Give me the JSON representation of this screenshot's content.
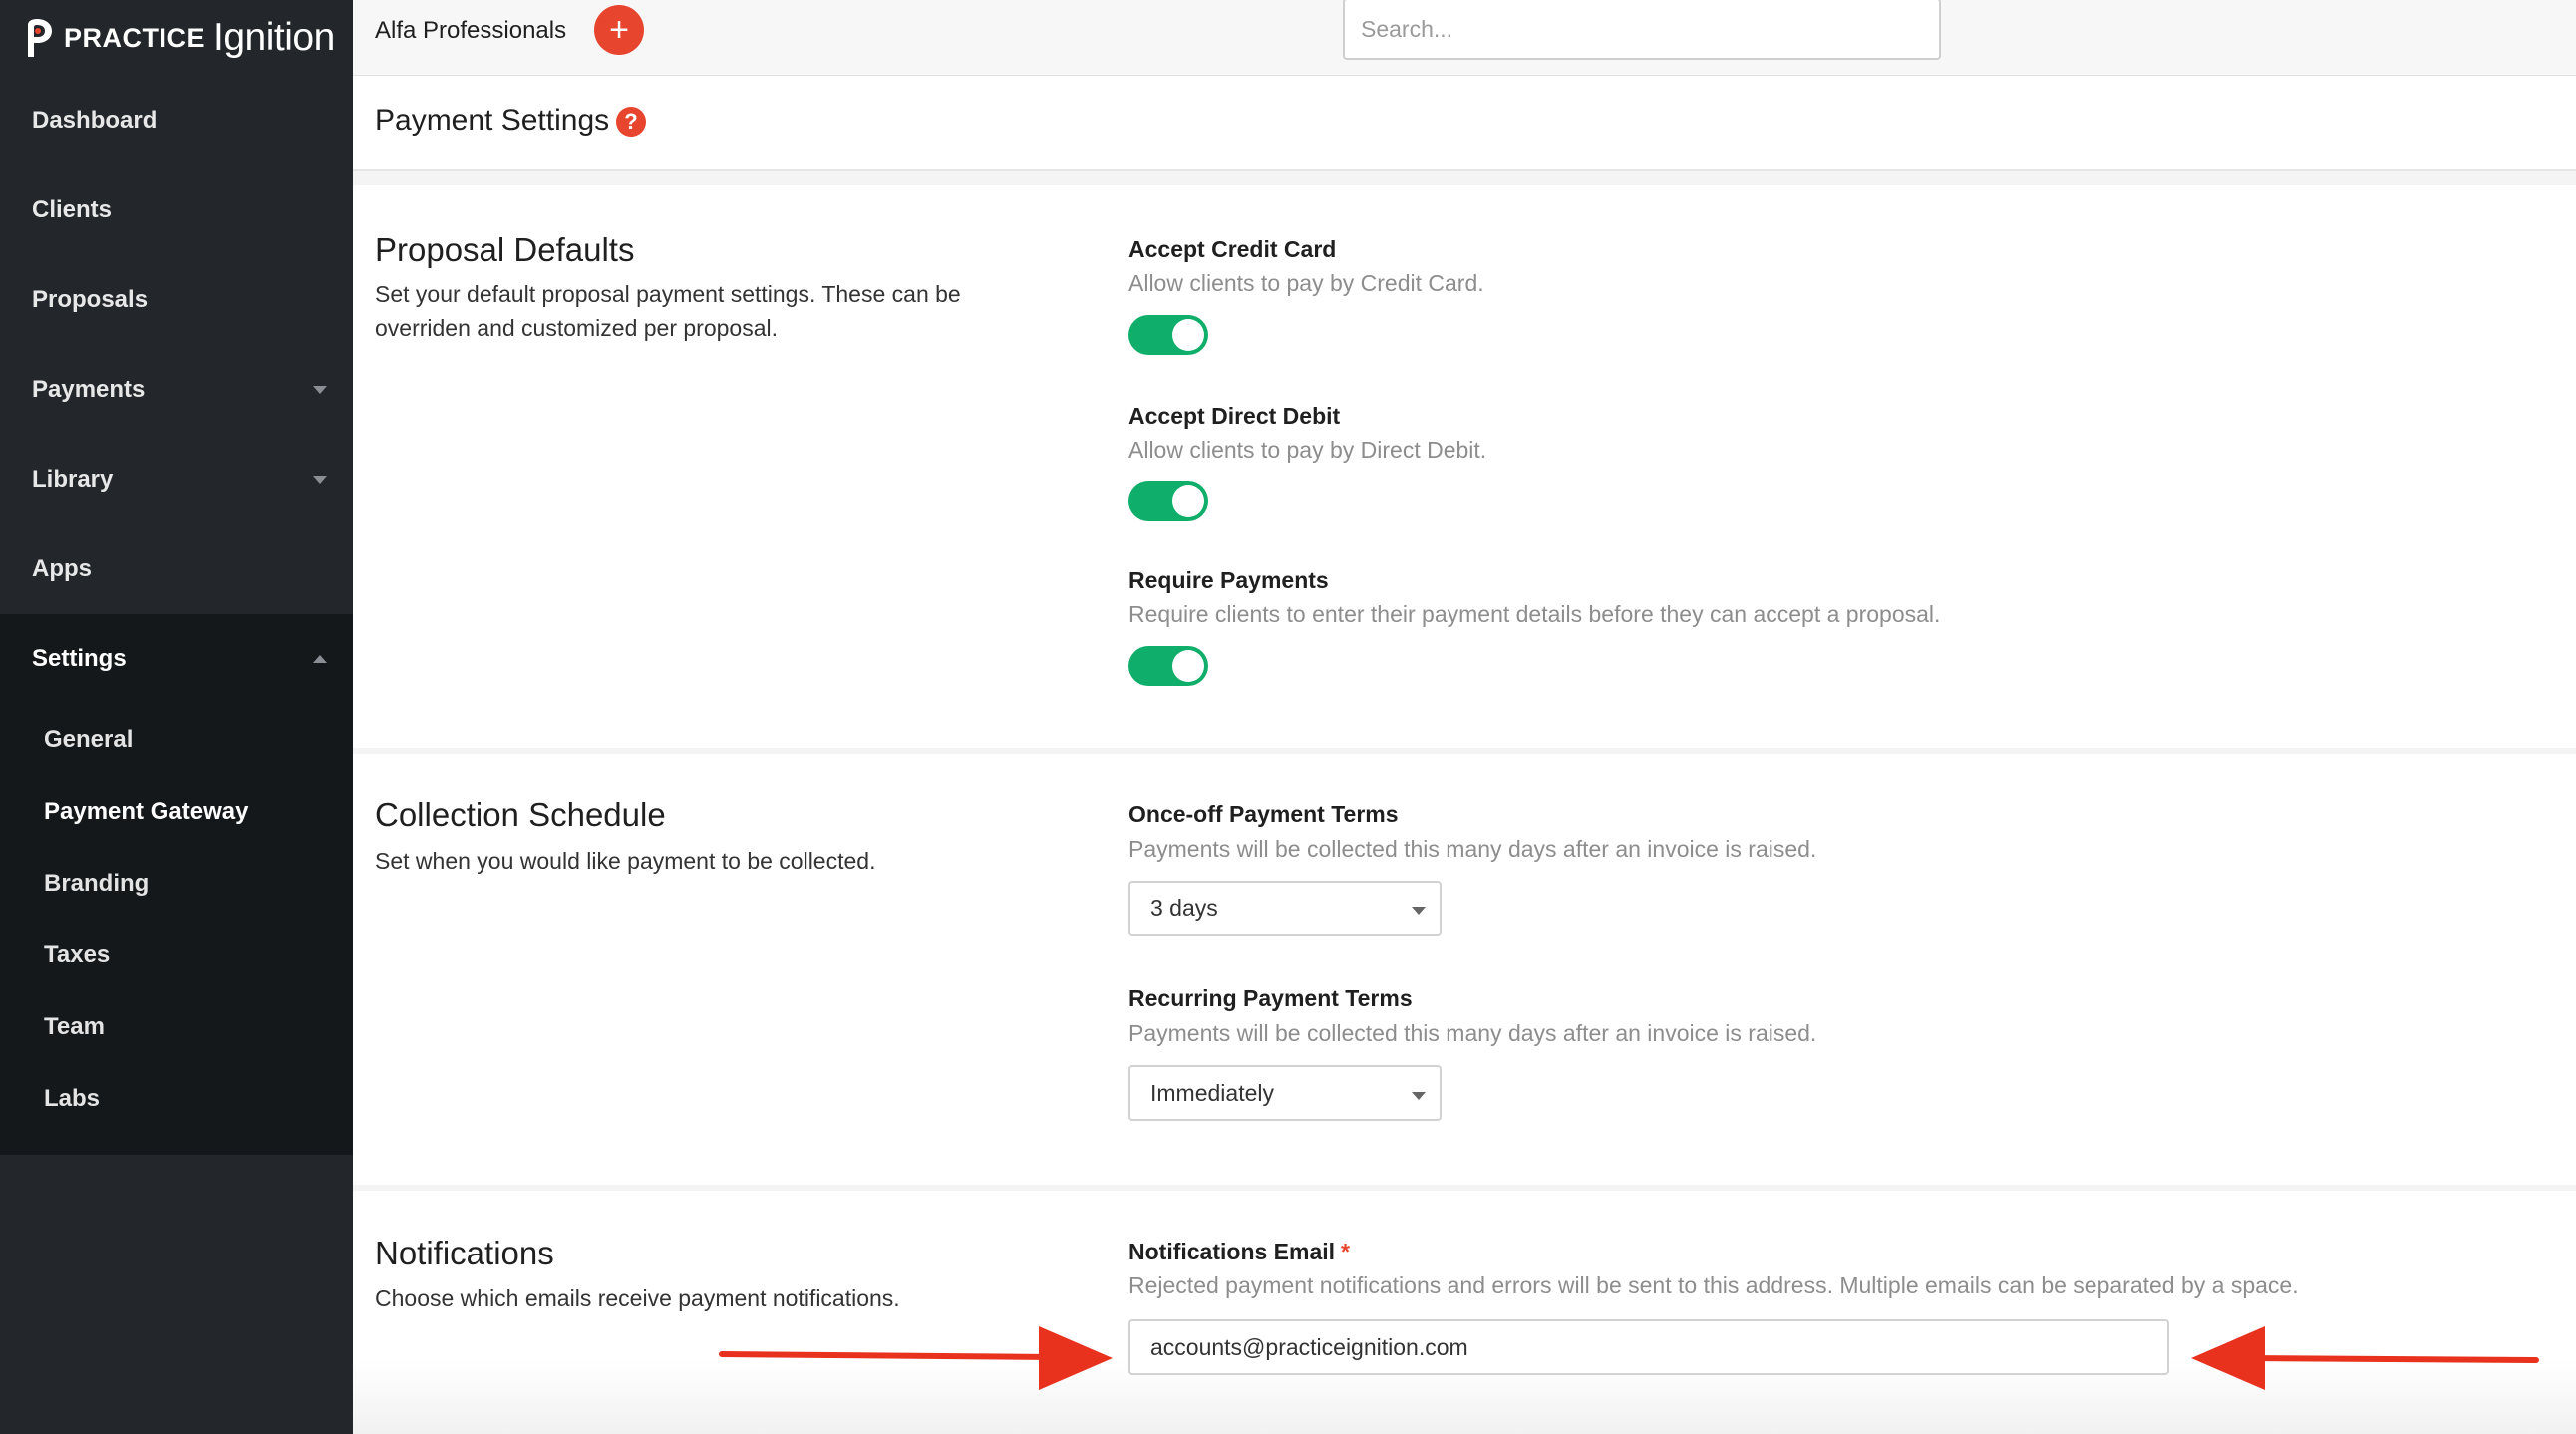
{
  "brand": {
    "practice": "PRACTICE",
    "ignition": "Ignition",
    "accent": "#e8452e",
    "toggle_on": "#0fae6a"
  },
  "sidebar": {
    "items": [
      {
        "label": "Dashboard"
      },
      {
        "label": "Clients"
      },
      {
        "label": "Proposals"
      },
      {
        "label": "Payments",
        "icon": "chevron-down-icon"
      },
      {
        "label": "Library",
        "icon": "chevron-down-icon"
      },
      {
        "label": "Apps"
      }
    ],
    "settings": {
      "label": "Settings",
      "icon": "chevron-up-icon",
      "children": [
        {
          "label": "General"
        },
        {
          "label": "Payment Gateway",
          "active": true
        },
        {
          "label": "Branding"
        },
        {
          "label": "Taxes"
        },
        {
          "label": "Team"
        },
        {
          "label": "Labs"
        }
      ]
    }
  },
  "topbar": {
    "org_name": "Alfa Professionals",
    "add_label": "+",
    "search_placeholder": "Search..."
  },
  "page": {
    "title": "Payment Settings",
    "help_label": "?"
  },
  "sections": {
    "proposal_defaults": {
      "heading": "Proposal Defaults",
      "description": "Set your default proposal payment settings. These can be overriden and customized per proposal.",
      "fields": [
        {
          "label": "Accept Credit Card",
          "help": "Allow clients to pay by Credit Card.",
          "enabled": true
        },
        {
          "label": "Accept Direct Debit",
          "help": "Allow clients to pay by Direct Debit.",
          "enabled": true
        },
        {
          "label": "Require Payments",
          "help": "Require clients to enter their payment details before they can accept a proposal.",
          "enabled": true
        }
      ]
    },
    "collection_schedule": {
      "heading": "Collection Schedule",
      "description": "Set when you would like payment to be collected.",
      "fields": [
        {
          "label": "Once-off Payment Terms",
          "help": "Payments will be collected this many days after an invoice is raised.",
          "value": "3 days"
        },
        {
          "label": "Recurring Payment Terms",
          "help": "Payments will be collected this many days after an invoice is raised.",
          "value": "Immediately"
        }
      ]
    },
    "notifications": {
      "heading": "Notifications",
      "description": "Choose which emails receive payment notifications.",
      "email_label": "Notifications Email",
      "required_mark": "*",
      "email_help": "Rejected payment notifications and errors will be sent to this address. Multiple emails can be separated by a space.",
      "email_value": "accounts@practiceignition.com"
    }
  },
  "annotation_color": "#e8321e"
}
